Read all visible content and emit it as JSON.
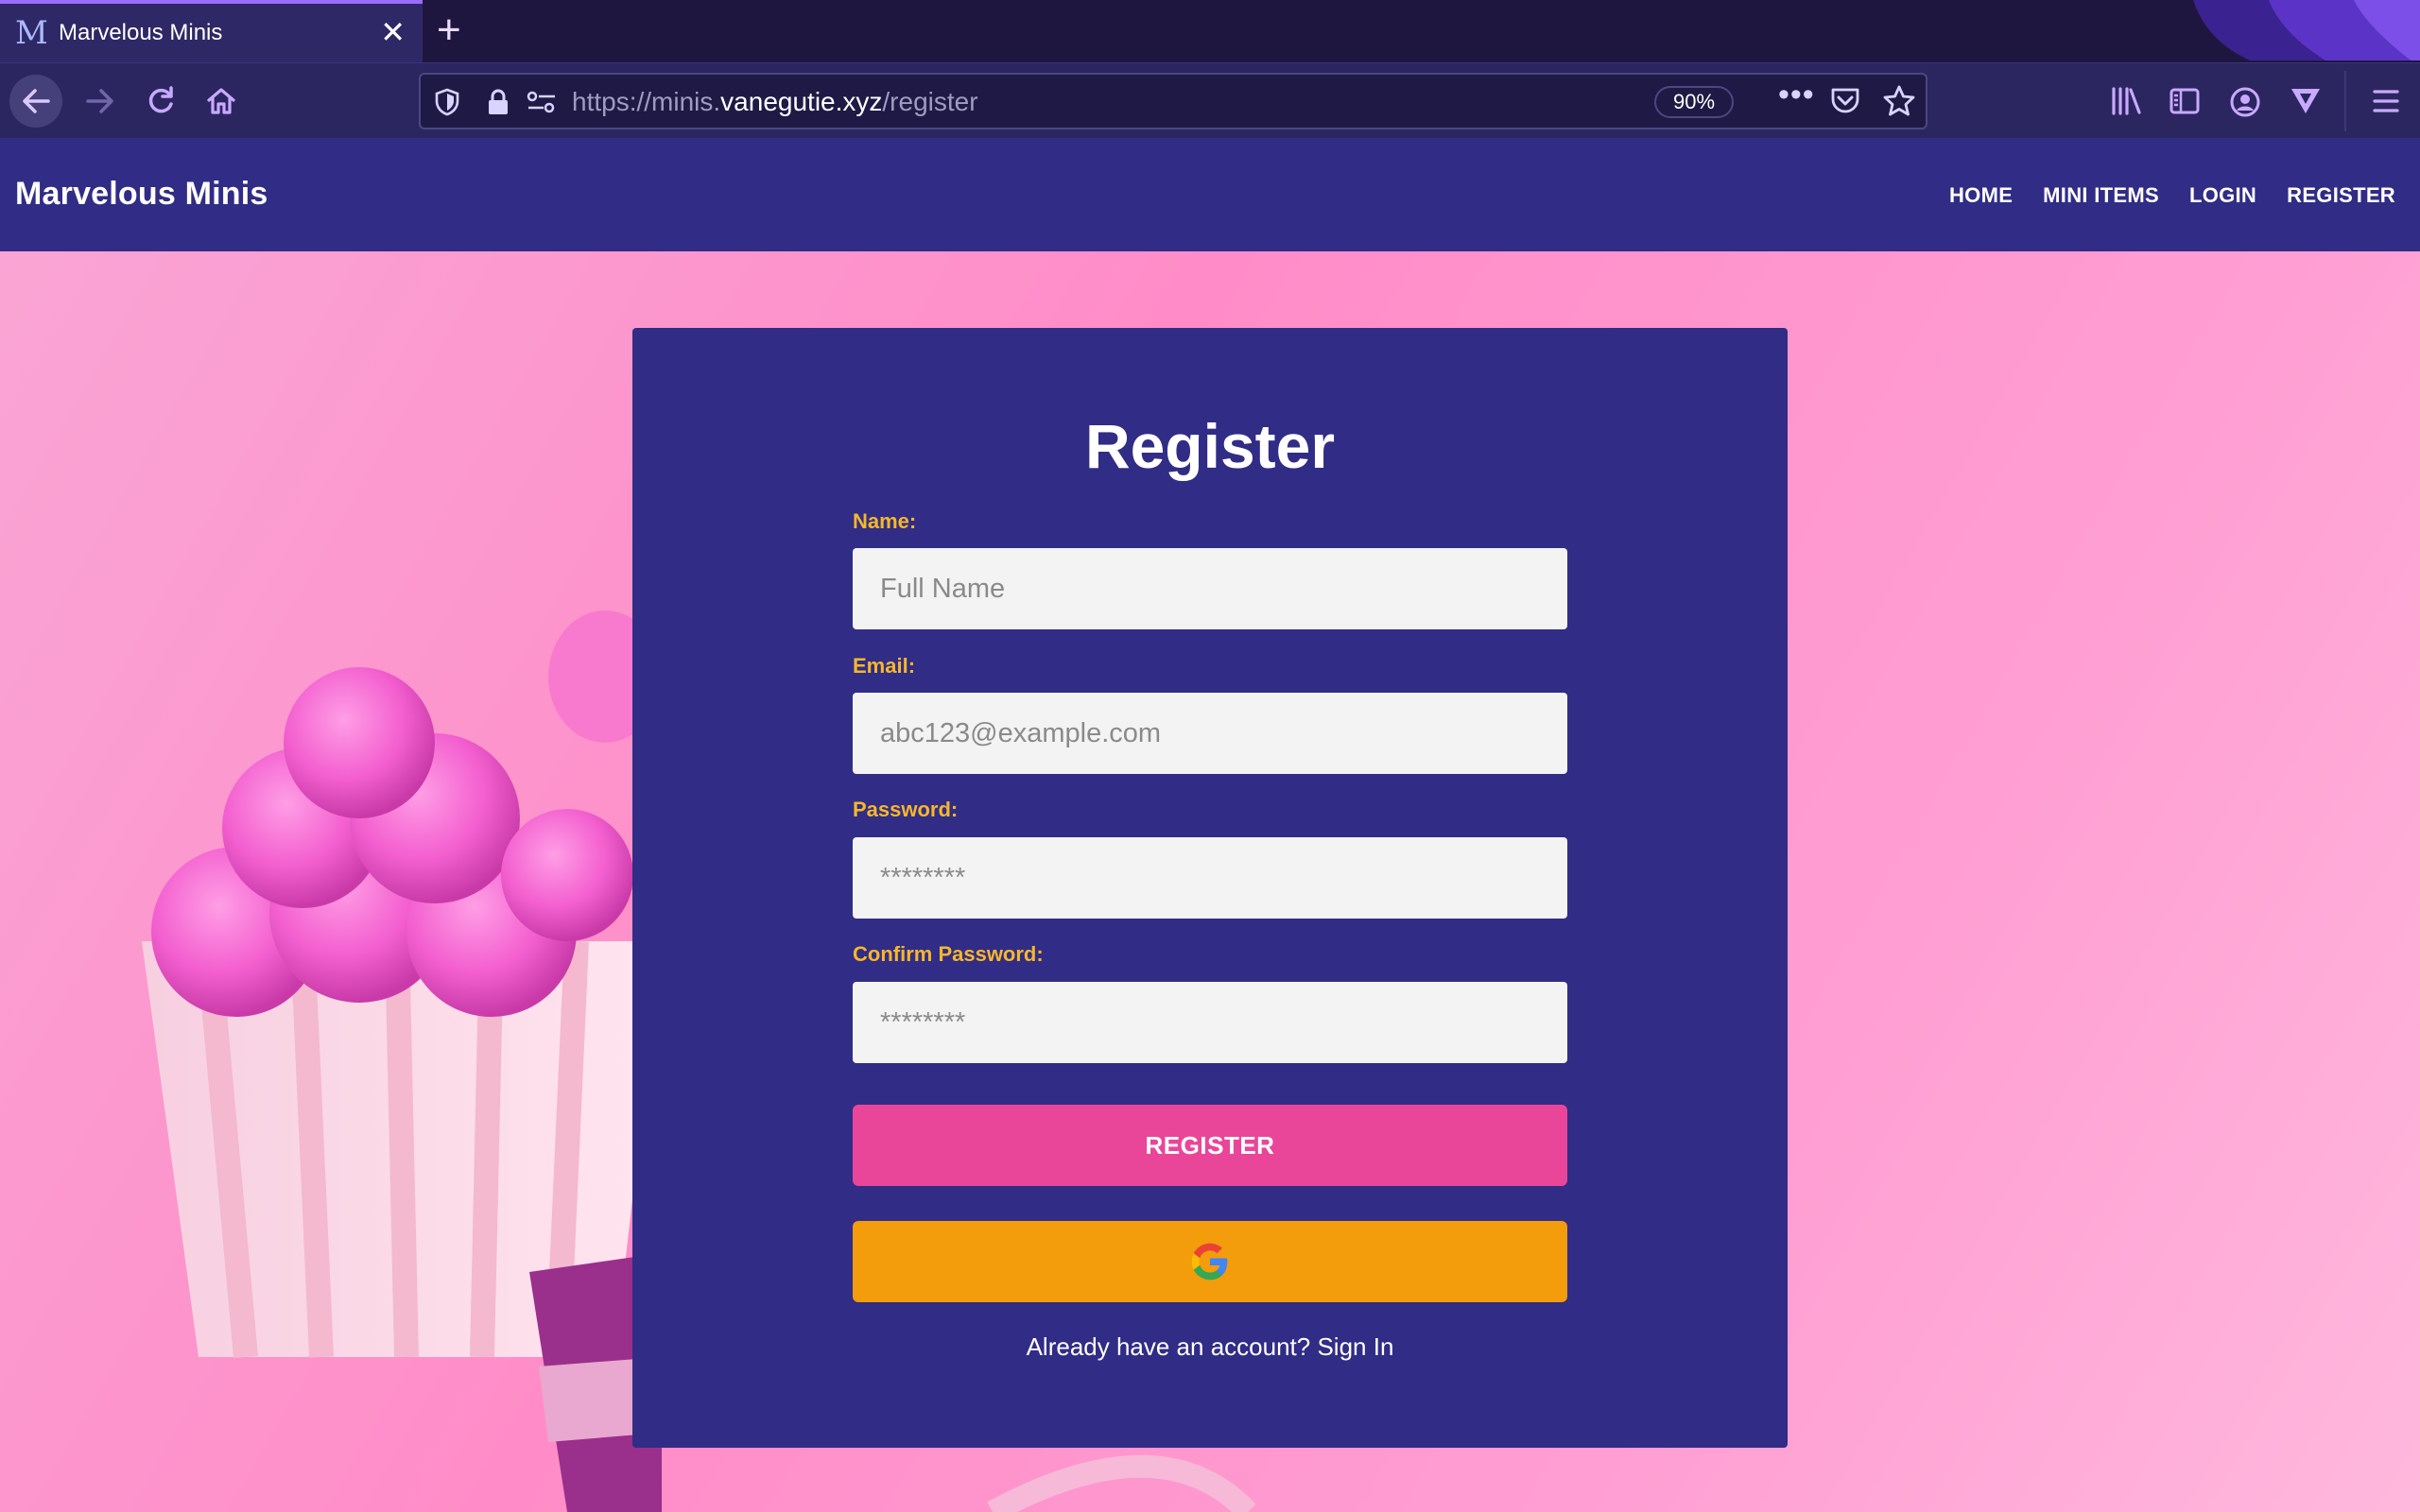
{
  "browser": {
    "tab_title": "Marvelous Minis",
    "tab_favicon": "M",
    "url_prefix": "https://minis.",
    "url_host": "vanegutie.xyz",
    "url_path": "/register",
    "zoom": "90%"
  },
  "site": {
    "brand": "Marvelous Minis",
    "nav": [
      "HOME",
      "MINI ITEMS",
      "LOGIN",
      "REGISTER"
    ]
  },
  "form": {
    "title": "Register",
    "name_label": "Name:",
    "name_placeholder": "Full Name",
    "email_label": "Email:",
    "email_placeholder": "abc123@example.com",
    "password_label": "Password:",
    "password_placeholder": "********",
    "confirm_label": "Confirm Password:",
    "confirm_placeholder": "********",
    "register_button": "REGISTER",
    "signin_text": "Already have an account? Sign In"
  },
  "colors": {
    "header": "#312c85",
    "card": "#312c85",
    "label": "#f5b72b",
    "register_button": "#e9469a",
    "google_button": "#f39c0c",
    "background": "#ff8cc8"
  },
  "icons": [
    "back-icon",
    "forward-icon",
    "reload-icon",
    "home-icon",
    "shield-icon",
    "lock-icon",
    "permissions-icon",
    "more-icon",
    "pocket-icon",
    "star-icon",
    "library-icon",
    "sidebar-icon",
    "account-icon",
    "extension-icon",
    "menu-icon",
    "google-icon"
  ]
}
